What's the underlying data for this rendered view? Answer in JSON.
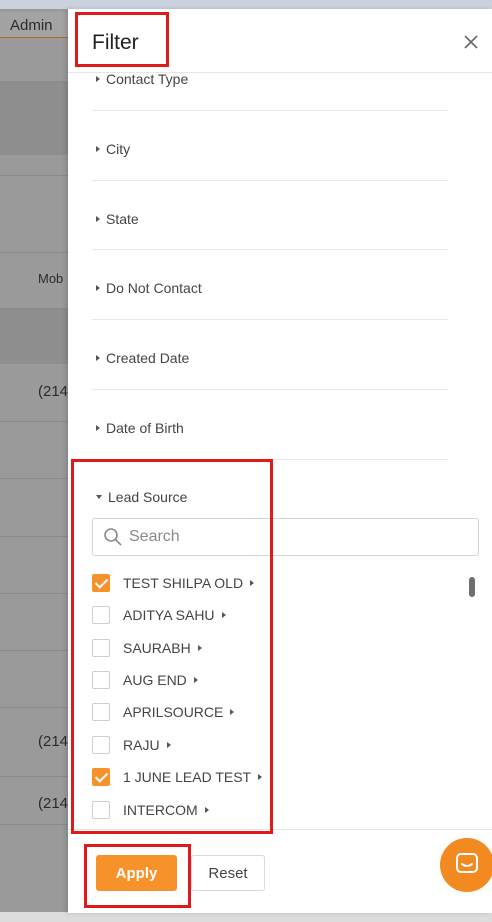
{
  "background": {
    "admin_label": "Admin",
    "col_fragment": "Mob",
    "phone_fragments": [
      "(214",
      "(214",
      "(214"
    ]
  },
  "drawer": {
    "title": "Filter",
    "close_icon": "close-icon"
  },
  "sections": [
    {
      "label": "Contact Type",
      "expanded": false
    },
    {
      "label": "City",
      "expanded": false
    },
    {
      "label": "State",
      "expanded": false
    },
    {
      "label": "Do Not Contact",
      "expanded": false
    },
    {
      "label": "Created Date",
      "expanded": false
    },
    {
      "label": "Date of Birth",
      "expanded": false
    },
    {
      "label": "Lead Source",
      "expanded": true
    }
  ],
  "lead_source": {
    "search_placeholder": "Search",
    "search_value": "",
    "options": [
      {
        "label": "TEST SHILPA OLD",
        "checked": true
      },
      {
        "label": "ADITYA SAHU",
        "checked": false
      },
      {
        "label": "SAURABH",
        "checked": false
      },
      {
        "label": "AUG END",
        "checked": false
      },
      {
        "label": "APRILSOURCE",
        "checked": false
      },
      {
        "label": "RAJU",
        "checked": false
      },
      {
        "label": "1 JUNE LEAD TEST",
        "checked": true
      },
      {
        "label": "INTERCOM",
        "checked": false
      }
    ]
  },
  "footer": {
    "apply_label": "Apply",
    "reset_label": "Reset"
  },
  "colors": {
    "accent": "#f7922a",
    "highlight": "#e01a1a",
    "overlay": "#9a9a9a"
  }
}
